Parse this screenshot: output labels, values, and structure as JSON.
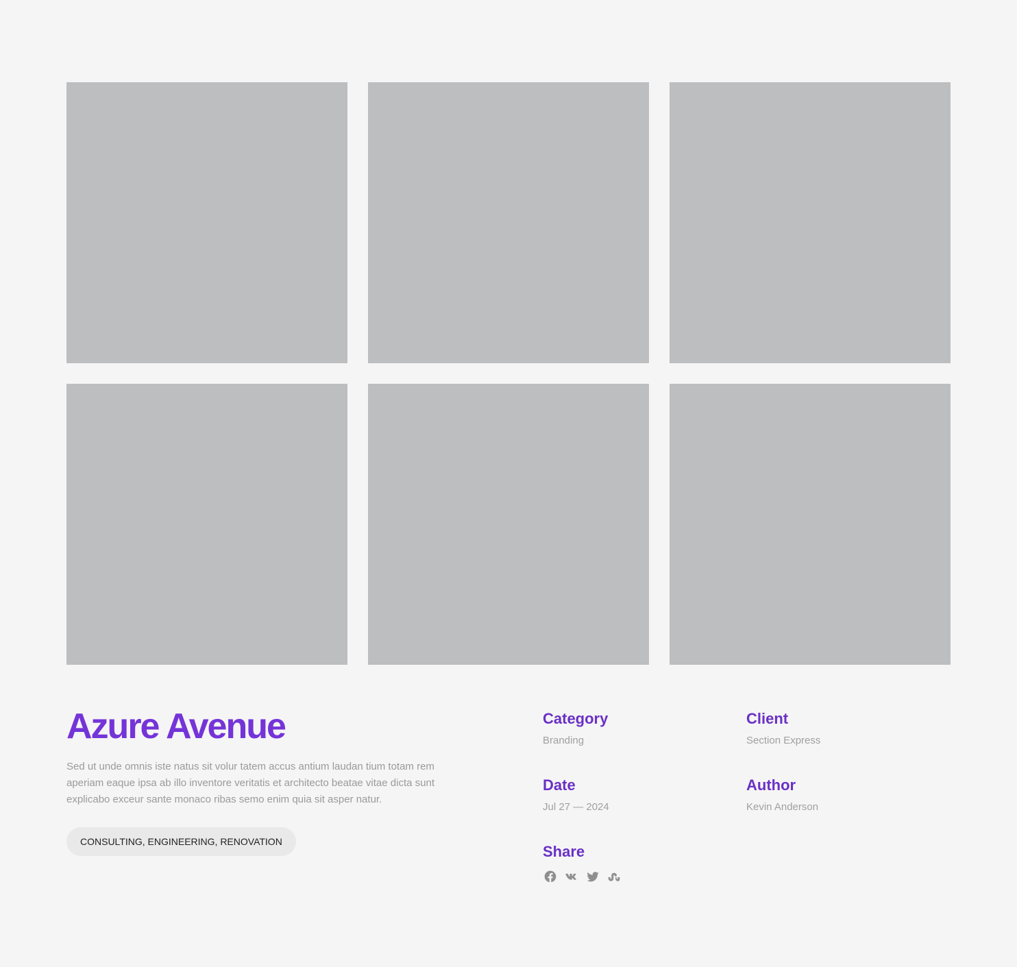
{
  "project": {
    "title": "Azure Avenue",
    "description": "Sed ut unde omnis iste natus sit volur tatem accus antium laudan tium totam rem aperiam eaque ipsa ab illo inventore veritatis et architecto beatae vitae dicta sunt explicabo exceur sante monaco ribas semo enim quia sit asper natur.",
    "tags": "CONSULTING, ENGINEERING, RENOVATION"
  },
  "meta": {
    "category": {
      "label": "Category",
      "value": "Branding"
    },
    "client": {
      "label": "Client",
      "value": "Section Express"
    },
    "date": {
      "label": "Date",
      "value": "Jul 27 — 2024"
    },
    "author": {
      "label": "Author",
      "value": "Kevin Anderson"
    },
    "share": {
      "label": "Share",
      "icons": [
        "facebook-icon",
        "vk-icon",
        "twitter-icon",
        "stumbleupon-icon"
      ]
    }
  },
  "colors": {
    "accent": "#7434d8",
    "label": "#6a30c6",
    "placeholder": "#bdbec0",
    "background": "#f5f5f5",
    "muted_text": "#9a9a9a",
    "tag_bg": "#e9e9e9",
    "icon": "#8f8f8f"
  }
}
